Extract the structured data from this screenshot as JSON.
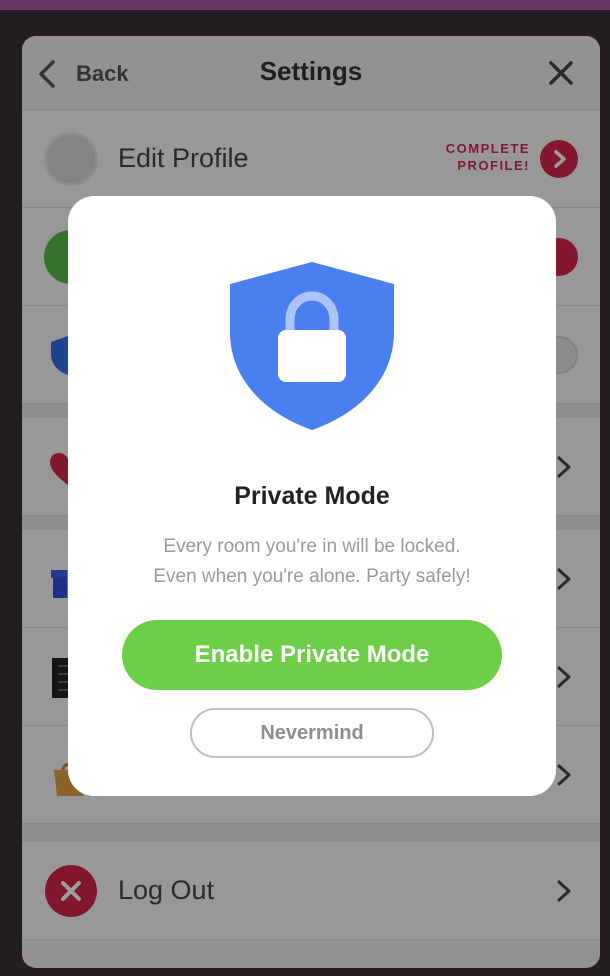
{
  "header": {
    "back_label": "Back",
    "title": "Settings"
  },
  "rows": {
    "edit_profile": {
      "label": "Edit Profile",
      "badge_line1": "COMPLETE",
      "badge_line2": "PROFILE!"
    },
    "log_out": {
      "label": "Log Out"
    }
  },
  "modal": {
    "title": "Private Mode",
    "description_line1": "Every room you're in will be locked.",
    "description_line2": "Even when you're alone. Party safely!",
    "enable_label": "Enable Private Mode",
    "nevermind_label": "Nevermind",
    "icon": "shield-lock-icon"
  },
  "colors": {
    "accent_red": "#d3264a",
    "enable_green": "#6ccf47",
    "shield_blue": "#4a7ff0",
    "frame_purple": "#a5579d"
  }
}
